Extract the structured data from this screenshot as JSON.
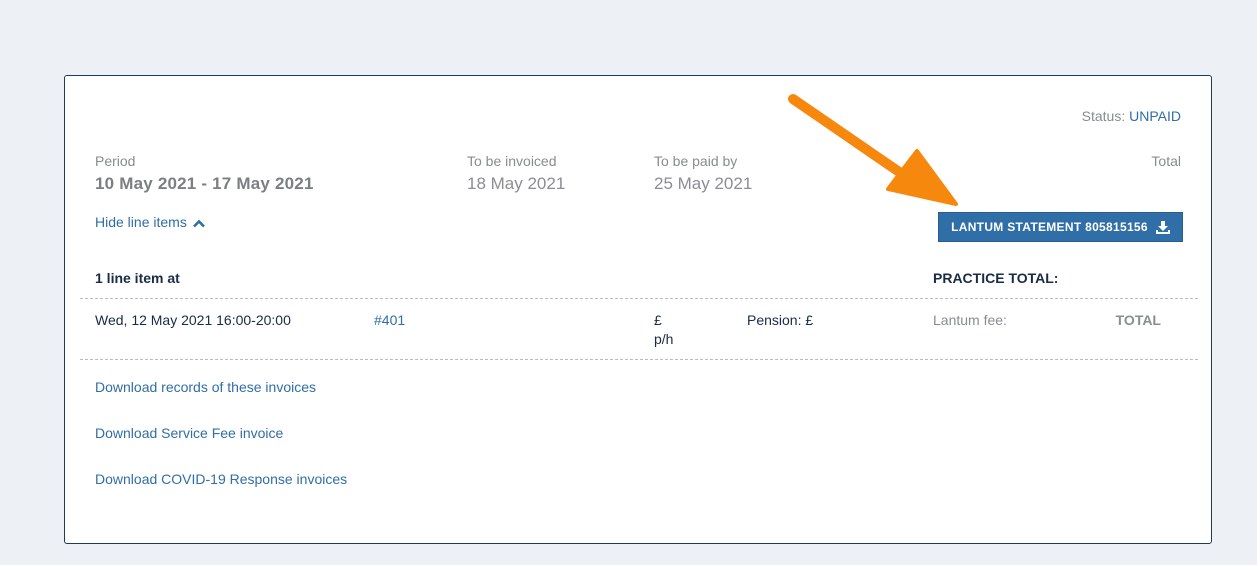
{
  "status": {
    "label": "Status:",
    "value": "UNPAID"
  },
  "summary": {
    "period_label": "Period",
    "period_value": "10 May 2021 - 17 May 2021",
    "invoiced_label": "To be invoiced",
    "invoiced_value": "18 May 2021",
    "paid_label": "To be paid by",
    "paid_value": "25 May 2021",
    "total_label": "Total"
  },
  "toggle_label": "Hide line items",
  "statement_button": {
    "label": "LANTUM STATEMENT 805815156",
    "icon": "download-icon"
  },
  "line_items_header": {
    "count_text": "1 line item at",
    "practice_total": "PRACTICE TOTAL:"
  },
  "line_item": {
    "date": "Wed, 12 May 2021 16:00-20:00",
    "ref": "#401",
    "rate_currency": "£",
    "rate_unit": "p/h",
    "pension": "Pension: £",
    "fee_label": "Lantum fee:",
    "total_label": "TOTAL"
  },
  "downloads": [
    "Download records of these invoices",
    "Download Service Fee invoice",
    "Download COVID-19 Response invoices"
  ],
  "colors": {
    "accent": "#2f6ea6",
    "arrow": "#f7880e",
    "border": "#1f3a5c"
  }
}
